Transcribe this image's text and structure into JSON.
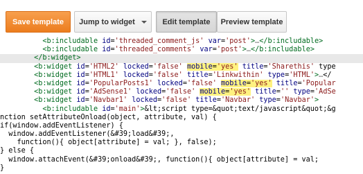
{
  "toolbar": {
    "save_label": "Save template",
    "jump_label": "Jump to widget",
    "edit_label": "Edit template",
    "preview_label": "Preview template"
  },
  "colors": {
    "save_button": "#ec7d1e",
    "tag": "#006b1f",
    "attribute_name": "#000080",
    "attribute_value": "#8b1a1a",
    "highlight": "#fff280"
  },
  "code_lines": [
    "          <b:includable id='threaded_comment_js' var='post'>…</b:includable>",
    "          <b:includable id='threaded_comments' var='post'>…</b:includable>",
    "        </b:widget>",
    "        <b:widget id='HTML2' locked='false' mobile='yes' title='Sharethis' type",
    "        <b:widget id='HTML1' locked='false' title='Linkwithin' type='HTML'>…</",
    "        <b:widget id='PopularPosts1' locked='false' mobile='yes' title='Popular",
    "        <b:widget id='AdSense1' locked='false' mobile='yes' title='' type='AdSe",
    "        <b:widget id='Navbar1' locked='false' title='Navbar' type='Navbar'>",
    "          <b:includable id='main'>&lt;script type=&quot;text/javascript&quot;&g",
    "nction setAttributeOnload(object, attribute, val) {",
    "if(window.addEventListener) {",
    "  window.addEventListener(&#39;load&#39;,",
    "    function(){ object[attribute] = val; }, false);",
    "} else {",
    "  window.attachEvent(&#39;onload&#39;, function(){ object[attribute] = val;",
    "}"
  ]
}
